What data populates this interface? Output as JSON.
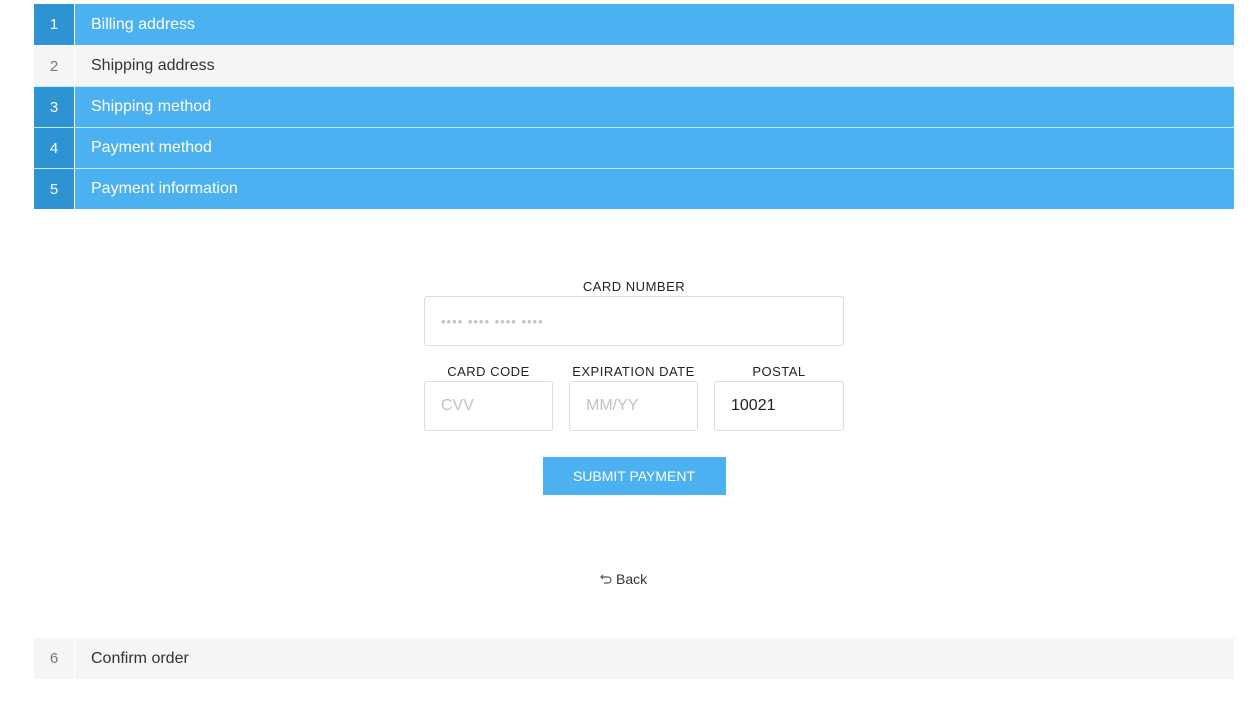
{
  "steps": [
    {
      "num": "1",
      "label": "Billing address",
      "state": "active"
    },
    {
      "num": "2",
      "label": "Shipping address",
      "state": "inactive"
    },
    {
      "num": "3",
      "label": "Shipping method",
      "state": "active"
    },
    {
      "num": "4",
      "label": "Payment method",
      "state": "active"
    },
    {
      "num": "5",
      "label": "Payment information",
      "state": "active"
    }
  ],
  "payment": {
    "card_number_label": "CARD NUMBER",
    "card_number_placeholder": "•••• •••• •••• ••••",
    "card_code_label": "CARD CODE",
    "card_code_placeholder": "CVV",
    "expiration_label": "EXPIRATION DATE",
    "expiration_placeholder": "MM/YY",
    "postal_label": "POSTAL",
    "postal_value": "10021",
    "submit_label": "SUBMIT PAYMENT",
    "back_label": "Back"
  },
  "final_step": {
    "num": "6",
    "label": "Confirm order"
  },
  "colors": {
    "accent": "#4bb1f0",
    "accent_dark": "#2d93d3",
    "inactive_bg": "#f5f5f5"
  },
  "icons": {
    "back": "undo-arrow-icon"
  }
}
